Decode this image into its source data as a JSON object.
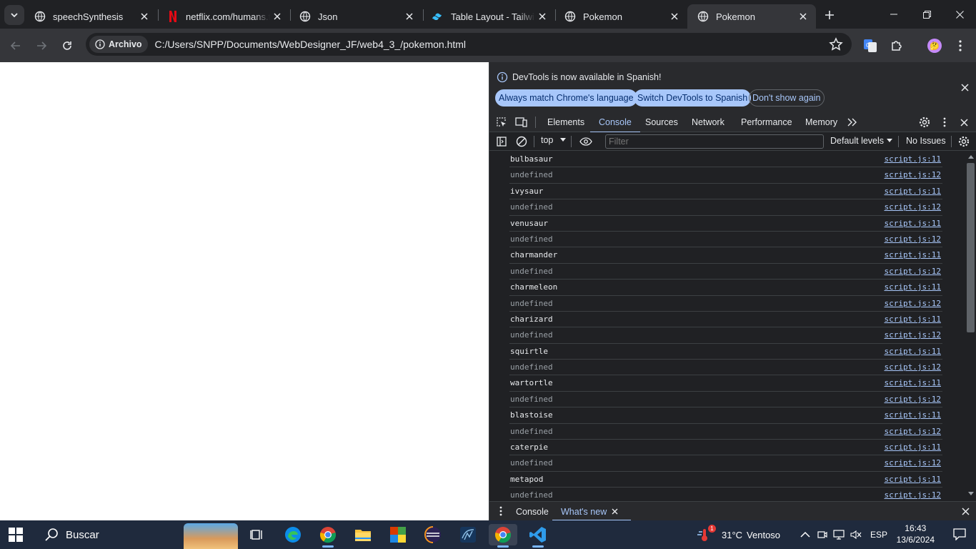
{
  "browser": {
    "tabs": [
      {
        "title": "speechSynthesis",
        "icon": "globe-icon",
        "active": false
      },
      {
        "title": "netflix.com/humans.txt",
        "icon": "netflix-icon",
        "active": false
      },
      {
        "title": "Json",
        "icon": "globe-icon",
        "active": false
      },
      {
        "title": "Table Layout - Tailwind",
        "icon": "tailwind-icon",
        "active": false
      },
      {
        "title": "Pokemon",
        "icon": "globe-icon",
        "active": false
      },
      {
        "title": "Pokemon",
        "icon": "globe-icon",
        "active": true
      }
    ],
    "address": {
      "chip_label": "Archivo",
      "url": "C:/Users/SNPP/Documents/WebDesigner_JF/web4_3_/pokemon.html"
    }
  },
  "devtools": {
    "infobar": {
      "message": "DevTools is now available in Spanish!",
      "btn_match": "Always match Chrome's language",
      "btn_switch": "Switch DevTools to Spanish",
      "btn_dont_show": "Don't show again"
    },
    "tabs": [
      "Elements",
      "Console",
      "Sources",
      "Network",
      "Performance",
      "Memory"
    ],
    "active_tab": "Console",
    "console_toolbar": {
      "context": "top",
      "filter_placeholder": "Filter",
      "levels": "Default levels",
      "issues": "No Issues"
    },
    "logs": [
      {
        "text": "bulbasaur",
        "kind": "value",
        "source": "script.js:11"
      },
      {
        "text": "undefined",
        "kind": "undefined",
        "source": "script.js:12"
      },
      {
        "text": "ivysaur",
        "kind": "value",
        "source": "script.js:11"
      },
      {
        "text": "undefined",
        "kind": "undefined",
        "source": "script.js:12"
      },
      {
        "text": "venusaur",
        "kind": "value",
        "source": "script.js:11"
      },
      {
        "text": "undefined",
        "kind": "undefined",
        "source": "script.js:12"
      },
      {
        "text": "charmander",
        "kind": "value",
        "source": "script.js:11"
      },
      {
        "text": "undefined",
        "kind": "undefined",
        "source": "script.js:12"
      },
      {
        "text": "charmeleon",
        "kind": "value",
        "source": "script.js:11"
      },
      {
        "text": "undefined",
        "kind": "undefined",
        "source": "script.js:12"
      },
      {
        "text": "charizard",
        "kind": "value",
        "source": "script.js:11"
      },
      {
        "text": "undefined",
        "kind": "undefined",
        "source": "script.js:12"
      },
      {
        "text": "squirtle",
        "kind": "value",
        "source": "script.js:11"
      },
      {
        "text": "undefined",
        "kind": "undefined",
        "source": "script.js:12"
      },
      {
        "text": "wartortle",
        "kind": "value",
        "source": "script.js:11"
      },
      {
        "text": "undefined",
        "kind": "undefined",
        "source": "script.js:12"
      },
      {
        "text": "blastoise",
        "kind": "value",
        "source": "script.js:11"
      },
      {
        "text": "undefined",
        "kind": "undefined",
        "source": "script.js:12"
      },
      {
        "text": "caterpie",
        "kind": "value",
        "source": "script.js:11"
      },
      {
        "text": "undefined",
        "kind": "undefined",
        "source": "script.js:12"
      },
      {
        "text": "metapod",
        "kind": "value",
        "source": "script.js:11"
      },
      {
        "text": "undefined",
        "kind": "undefined",
        "source": "script.js:12"
      }
    ],
    "drawer": {
      "tabs": [
        "Console",
        "What's new"
      ],
      "active": "What's new"
    }
  },
  "taskbar": {
    "search_label": "Buscar",
    "apps": [
      "file-explorer-icon",
      "task-view-icon",
      "edge-icon",
      "chrome-icon",
      "folder-icon",
      "minecraft-icon",
      "eclipse-icon",
      "mysql-workbench-icon",
      "chrome-icon",
      "vscode-icon"
    ],
    "weather": {
      "temp": "31°C",
      "condition": "Ventoso",
      "badge": "1"
    },
    "language": "ESP",
    "time": "16:43",
    "date": "13/6/2024"
  },
  "colors": {
    "accent": "#a8c7fa",
    "devtools_bg": "#202124",
    "chrome_frame": "#35363a",
    "taskbar": "#1f2a3d"
  }
}
